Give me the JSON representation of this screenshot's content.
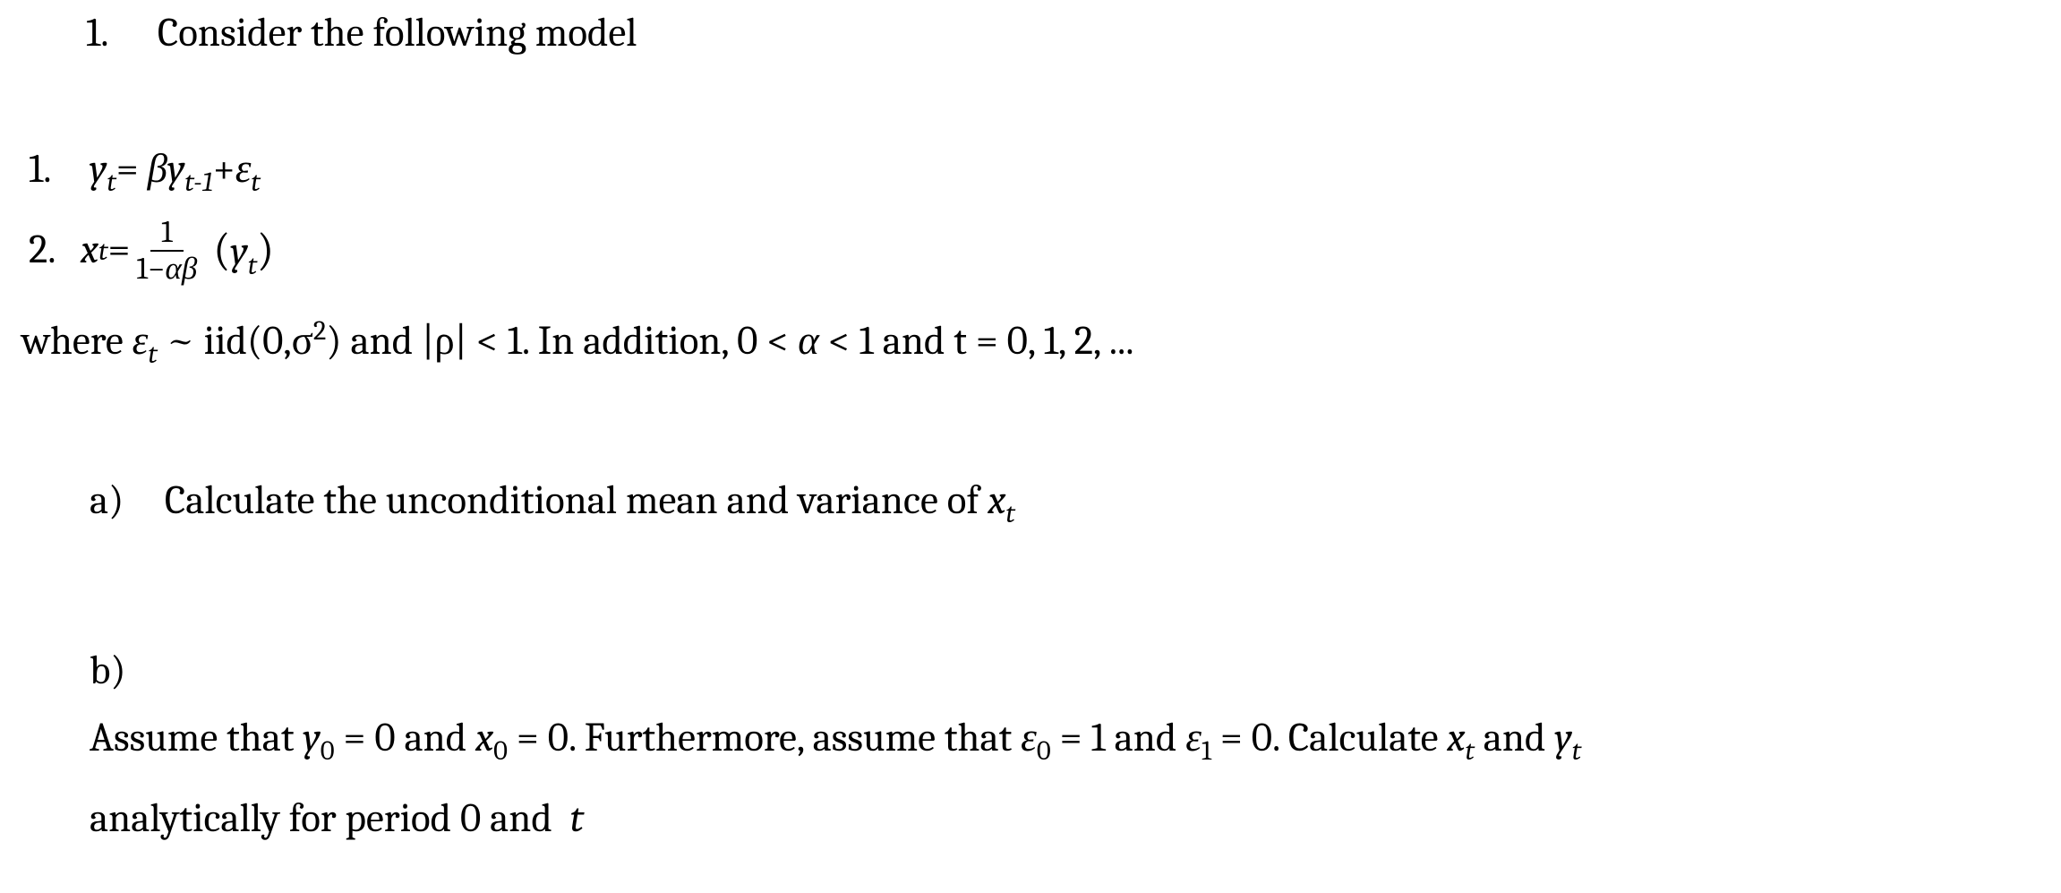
{
  "problem": {
    "number": "1.",
    "intro": "Consider the following model"
  },
  "equations": {
    "eq1": {
      "label": "1.",
      "lhs_var": "y",
      "lhs_sub": "t",
      "eq": "=",
      "beta": "β",
      "rhs_var1": "y",
      "rhs_sub1": "t-1",
      "plus": "+",
      "eps": "ε",
      "eps_sub": "t"
    },
    "eq2": {
      "label": "2.",
      "lhs_var": "x",
      "lhs_sub": "t",
      "eq": "=",
      "frac_num": "1",
      "frac_den_1": "1",
      "frac_den_minus": "−",
      "frac_den_alpha": "α",
      "frac_den_beta": "β",
      "paren_open": "(",
      "paren_var": "y",
      "paren_sub": "t",
      "paren_close": ")"
    }
  },
  "where": {
    "prefix": "where ",
    "eps": "ε",
    "eps_sub": "t",
    "tilde": " ~ ",
    "iid_open": "iid(0,",
    "sigma": "σ",
    "sigma_sup": "2",
    "iid_close": ")",
    "and1": " and |ρ| < 1. In addition, 0 < ",
    "alpha": "α",
    "and2": " < 1 and t = 0, 1, 2, ..."
  },
  "parts": {
    "a": {
      "label": "a)",
      "text_pre": "Calculate the unconditional mean and variance of ",
      "xvar": "x",
      "xsub": "t"
    },
    "b": {
      "label": "b)",
      "t1": "Assume that ",
      "y0v": "y",
      "y0s": "0",
      "t2": " = 0 and ",
      "x0v": "x",
      "x0s": "0",
      "t3": " = 0. Furthermore, assume that ",
      "e0v": "ε",
      "e0s": "0",
      "t4": " = 1 and ",
      "e1v": "ε",
      "e1s": "1",
      "t5": " = 0. Calculate ",
      "xtv": "x",
      "xts": "t",
      "t6": " and ",
      "ytv": "y",
      "yts": "t",
      "t7_line2": "analytically for period 0 and ",
      "t_it": "t"
    }
  }
}
